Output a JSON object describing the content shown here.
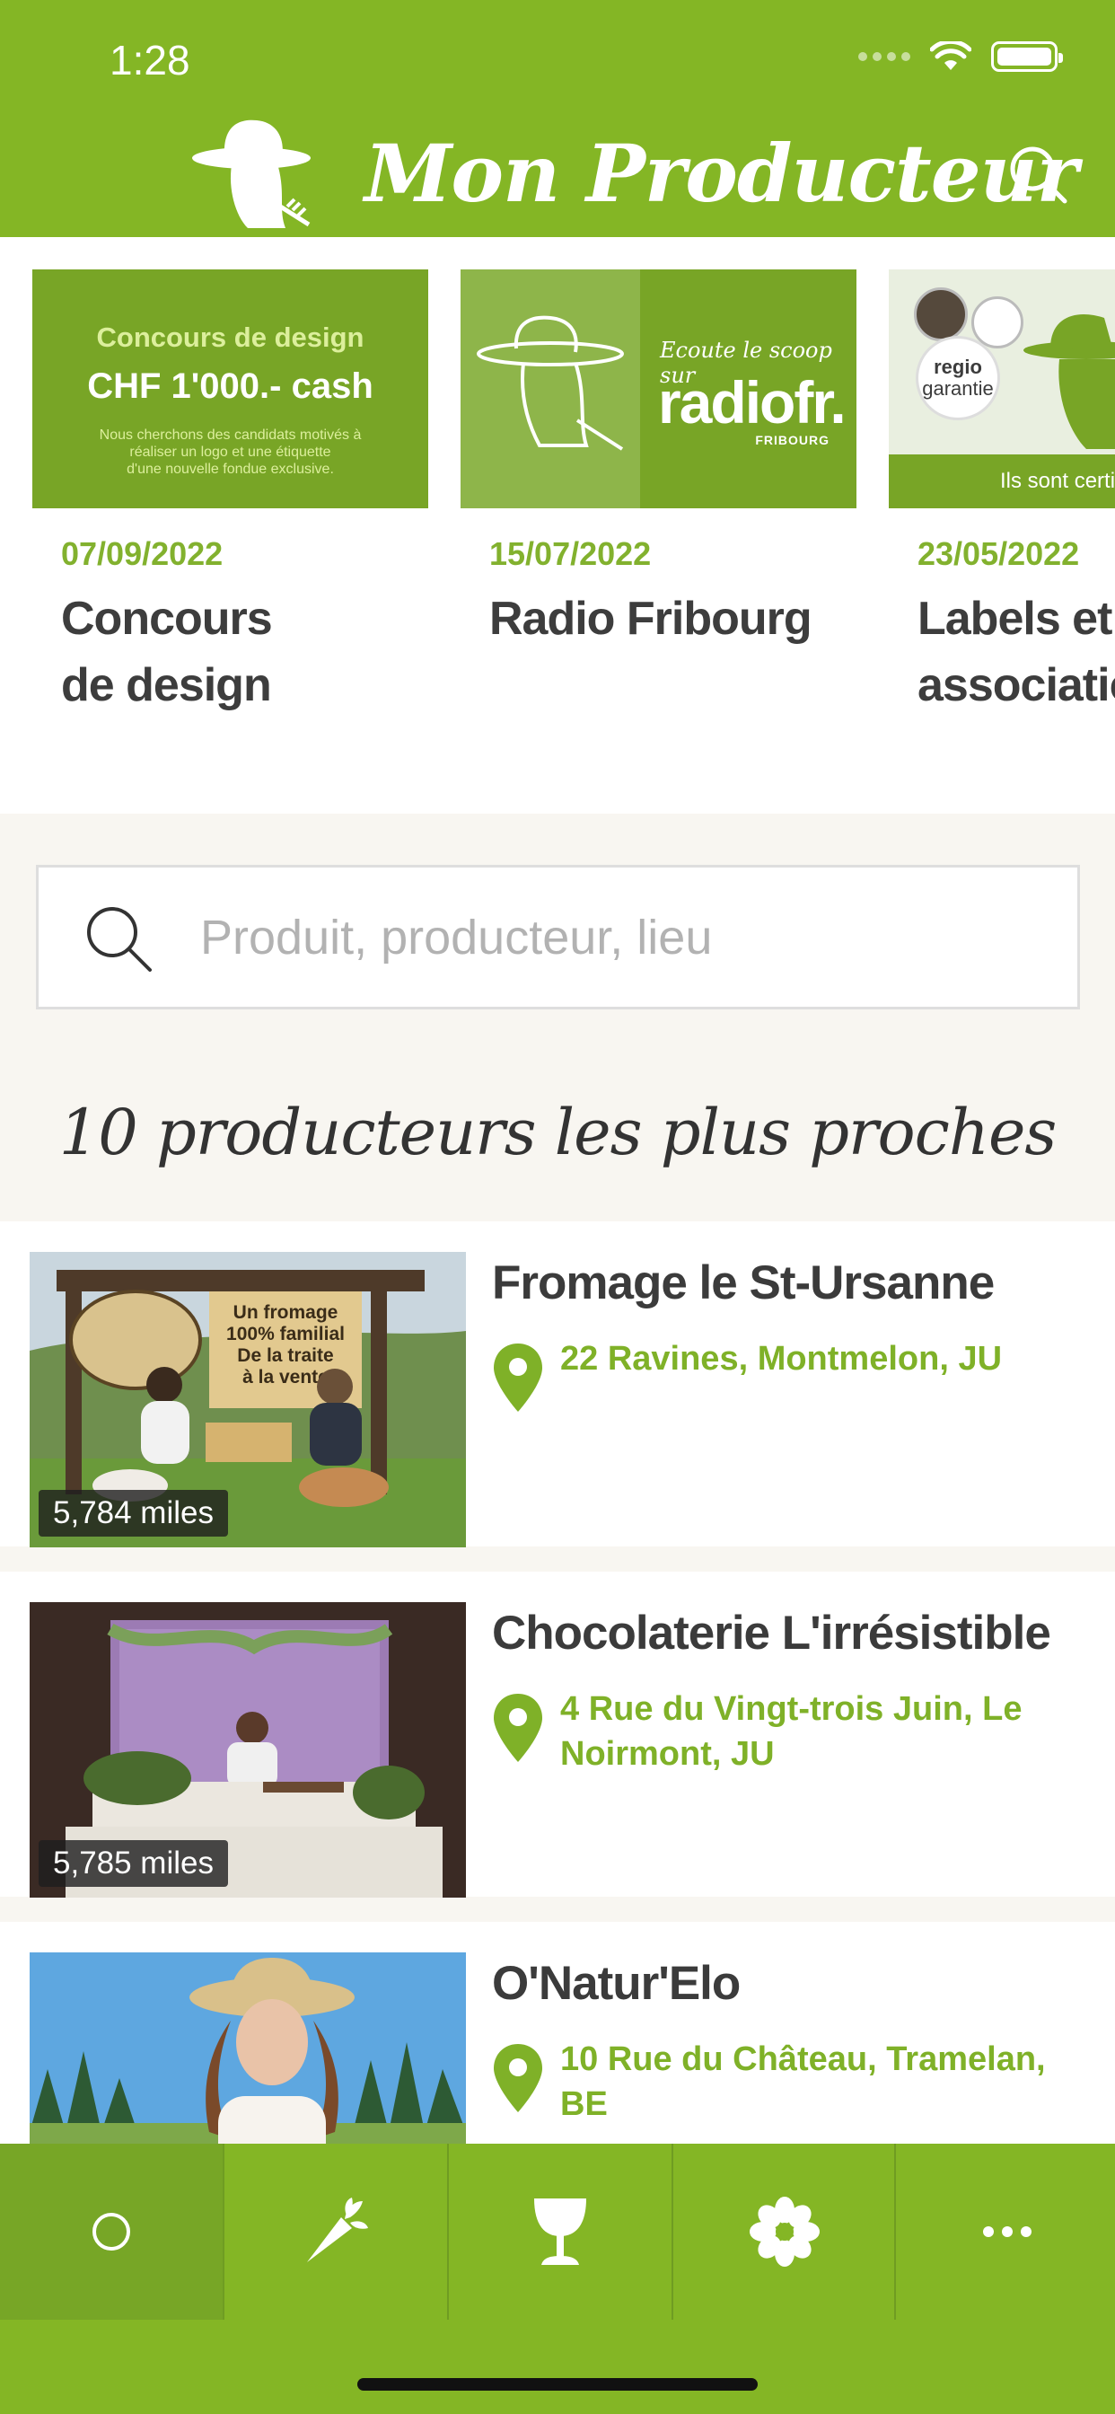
{
  "status_bar": {
    "time": "1:28"
  },
  "header": {
    "title": "Mon Producteur"
  },
  "news": [
    {
      "date": "07/09/2022",
      "title_line1": "Concours",
      "title_line2": "de design",
      "image_text": {
        "line1": "Concours de design",
        "line2": "CHF 1'000.- cash",
        "line3": "Nous cherchons des candidats motivés à",
        "line4": "réaliser un logo et une étiquette",
        "line5": "d'une nouvelle fondue exclusive."
      }
    },
    {
      "date": "15/07/2022",
      "title_line1": "Radio Fribourg",
      "title_line2": "",
      "image_text": {
        "small": "Ecoute le scoop sur",
        "big": "radiofr.",
        "sub": "FRIBOURG"
      }
    },
    {
      "date": "23/05/2022",
      "title_line1": "Labels et",
      "title_line2": "associations",
      "image_text": {
        "regio1": "regio",
        "regio2": "garantie",
        "band": "Ils sont certifiés"
      }
    }
  ],
  "search": {
    "placeholder": "Produit, producteur, lieu"
  },
  "section_title": "10 producteurs les plus proches",
  "producers": [
    {
      "name": "Fromage le St-Ursanne",
      "address": "22 Ravines, Montmelon, JU",
      "distance": "5,784 miles",
      "sign": {
        "line1": "Un fromage",
        "line2": "100% familial",
        "line3": "De la traite",
        "line4": "à la vente"
      }
    },
    {
      "name": "Chocolaterie L'irrésistible",
      "address": "4 Rue du Vingt-trois Juin, Le Noirmont, JU",
      "distance": "5,785 miles"
    },
    {
      "name": "O'Natur'Elo",
      "address": "10 Rue du Château, Tramelan, BE",
      "distance": ""
    }
  ],
  "tabs": [
    {
      "name": "home",
      "icon": "circle-icon"
    },
    {
      "name": "vegetables",
      "icon": "carrot-icon"
    },
    {
      "name": "drinks",
      "icon": "wine-glass-icon"
    },
    {
      "name": "flowers",
      "icon": "flower-icon"
    },
    {
      "name": "more",
      "icon": "more-icon"
    }
  ],
  "colors": {
    "brand_green": "#84b625",
    "dark_green": "#78a526",
    "text_dark": "#3c3c3c",
    "accent_text": "#82b12e"
  }
}
